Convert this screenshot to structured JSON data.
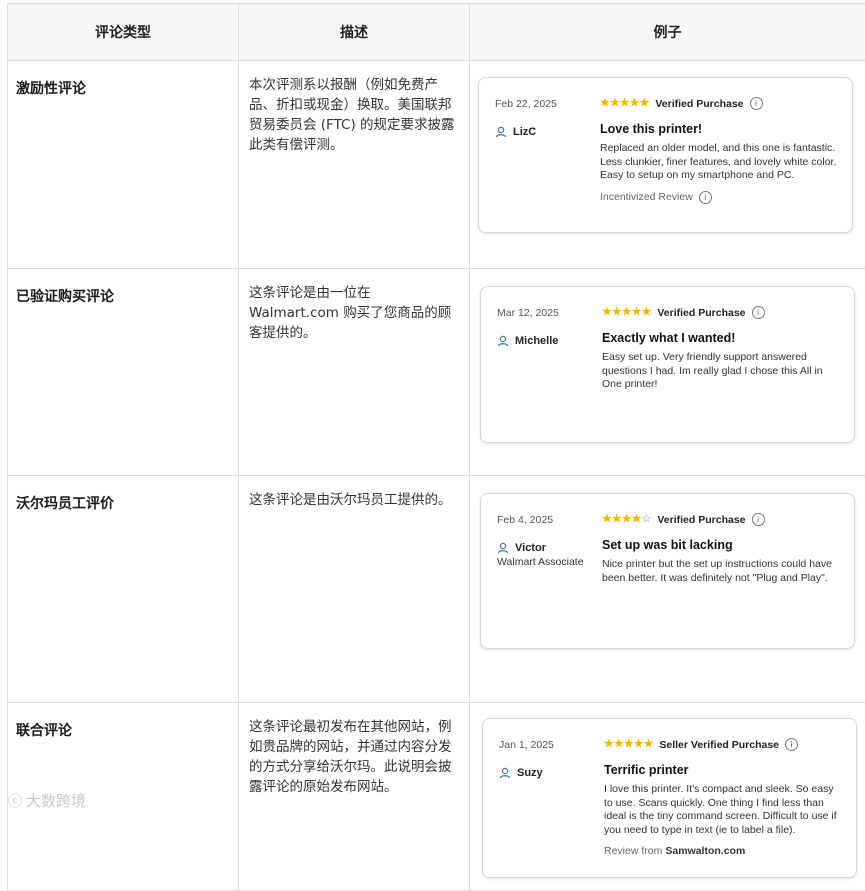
{
  "table": {
    "headers": {
      "type": "评论类型",
      "desc": "描述",
      "example": "例子"
    },
    "rows": [
      {
        "type": "激励性评论",
        "desc": "本次评测系以报酬（例如免费产品、折扣或现金）换取。美国联邦贸易委员会 (FTC) 的规定要求披露此类有偿评测。",
        "card": {
          "date": "Feb 22, 2025",
          "user": "LizC",
          "assoc": "",
          "stars": 5,
          "badge": "Verified Purchase",
          "title": "Love this printer!",
          "body": "Replaced an older model, and this one is fantastic. Less clunkier, finer features, and lovely white color. Easy to setup on my smartphone and PC.",
          "foot": "Incentivized Review",
          "foot_bold": ""
        }
      },
      {
        "type": "已验证购买评论",
        "desc": "这条评论是由一位在 Walmart.com 购买了您商品的顾客提供的。",
        "card": {
          "date": "Mar 12, 2025",
          "user": "Michelle",
          "assoc": "",
          "stars": 5,
          "badge": "Verified Purchase",
          "title": "Exactly what I wanted!",
          "body": "Easy set up. Very friendly support answered questions I had. Im really glad I chose this All in One printer!",
          "foot": "",
          "foot_bold": ""
        }
      },
      {
        "type": "沃尔玛员工评价",
        "desc": "这条评论是由沃尔玛员工提供的。",
        "card": {
          "date": "Feb 4, 2025",
          "user": "Victor",
          "assoc": "Walmart Associate",
          "stars": 4,
          "badge": "Verified Purchase",
          "title": "Set up was bit lacking",
          "body": "Nice printer but the set up instructions could have been better. It was definitely not \"Plug and Play\".",
          "foot": "",
          "foot_bold": ""
        }
      },
      {
        "type": "联合评论",
        "desc": "这条评论最初发布在其他网站，例如贵品牌的网站，并通过内容分发的方式分享给沃尔玛。此说明会披露评论的原始发布网站。",
        "card": {
          "date": "Jan 1, 2025",
          "user": "Suzy",
          "assoc": "",
          "stars": 5,
          "badge": "Seller Verified Purchase",
          "title": "Terrific printer",
          "body": "I love this printer. It's compact and sleek. So easy to use. Scans quickly. One thing I find less than ideal is the tiny command screen. Difficult to use if you need to type in text (ie to label a file).",
          "foot": "Review from",
          "foot_bold": "Samwalton.com"
        }
      }
    ]
  },
  "watermark": "大数跨境",
  "colors": {
    "star": "#f2b600",
    "star_empty": "#c8c8c8",
    "border": "#dcdcdc",
    "header_bg": "#f7f7f7"
  },
  "icons": {
    "user": "user-icon",
    "info": "info-icon",
    "star": "star-icon"
  }
}
